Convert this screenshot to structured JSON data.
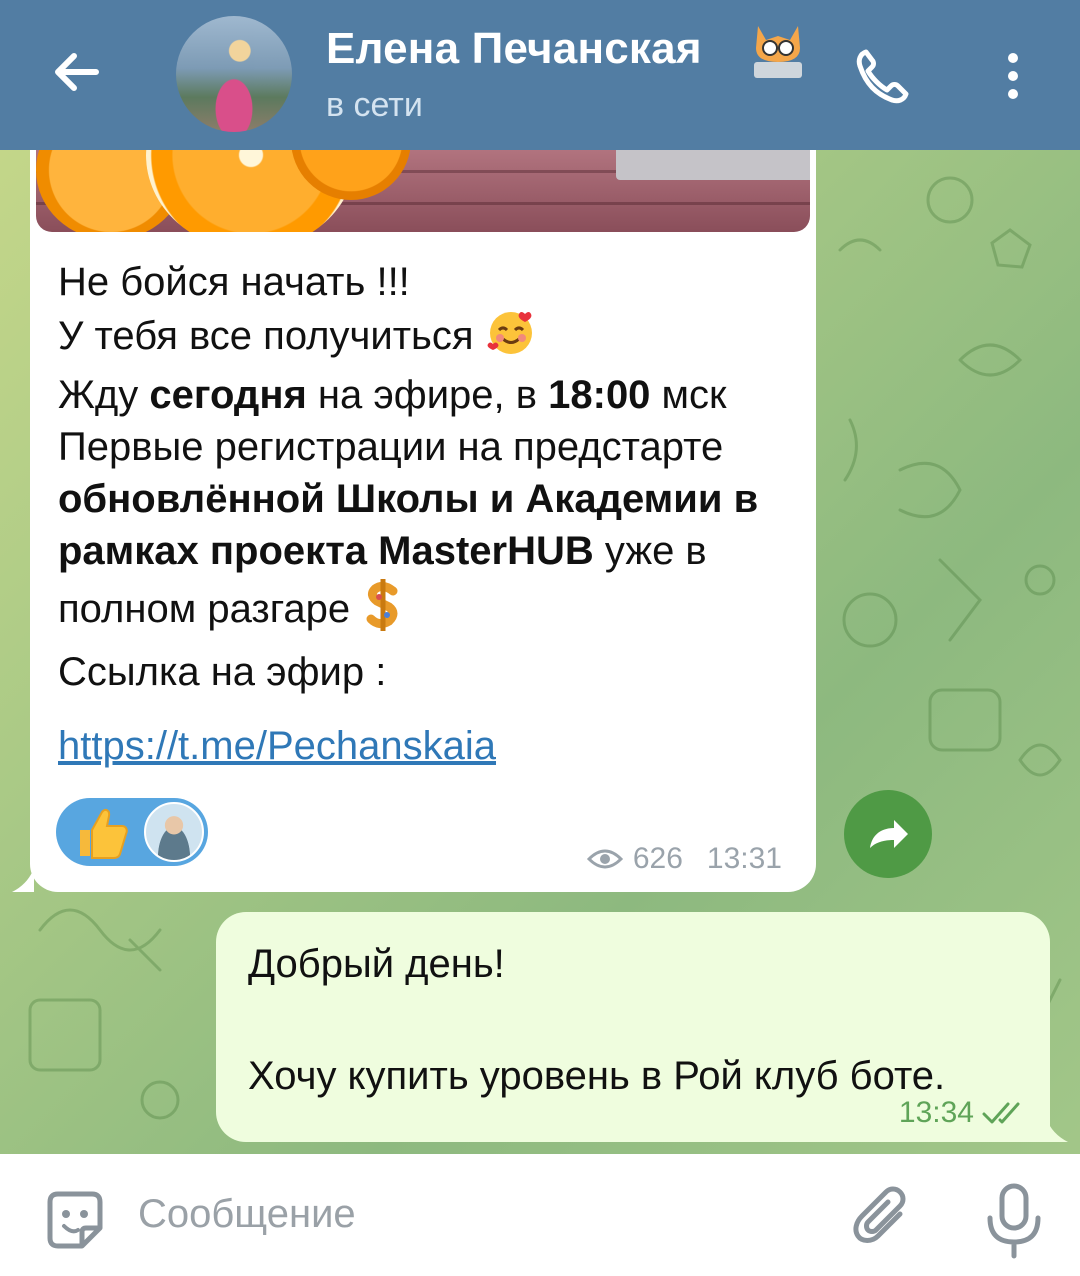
{
  "header": {
    "contact_name": "Елена Печанская",
    "status": "в сети"
  },
  "incoming": {
    "lines": [
      {
        "parts": [
          {
            "t": "Не бойся начать !!!",
            "b": false
          }
        ]
      },
      {
        "parts": [
          {
            "t": "У тебя все получиться ",
            "b": false
          }
        ],
        "emoji": "smiling-face-with-hearts"
      },
      {
        "parts": [
          {
            "t": "Жду ",
            "b": false
          },
          {
            "t": "сегодня",
            "b": true
          },
          {
            "t": " на эфире, в ",
            "b": false
          },
          {
            "t": "18:00",
            "b": true
          },
          {
            "t": " мск",
            "b": false
          }
        ]
      },
      {
        "parts": [
          {
            "t": "Первые регистрации на предстарте",
            "b": false
          }
        ]
      },
      {
        "parts": [
          {
            "t": "обновлённой Школы и Академии в",
            "b": true
          }
        ]
      },
      {
        "parts": [
          {
            "t": "рамках проекта MasterHUB",
            "b": true
          },
          {
            "t": " уже в",
            "b": false
          }
        ]
      },
      {
        "parts": [
          {
            "t": "полном разгаре  ",
            "b": false
          }
        ],
        "emoji": "money-sign"
      },
      {
        "parts": [
          {
            "t": "Ссылка на эфир :",
            "b": false
          }
        ]
      }
    ],
    "link": "https://t.me/Pechanskaia",
    "reaction_emoji": "thumbs-up",
    "views": "626",
    "time": "13:31"
  },
  "outgoing": {
    "text": "Добрый день!\n\nХочу купить уровень в Рой клуб боте.",
    "time": "13:34",
    "status_icon": "double-check"
  },
  "input": {
    "placeholder": "Сообщение"
  },
  "colors": {
    "header_bg": "#527da3",
    "outgoing_bg": "#effdde",
    "link": "#2f78b7",
    "reaction_bg": "#58a6e0",
    "forward_bg": "#4f9a45"
  }
}
